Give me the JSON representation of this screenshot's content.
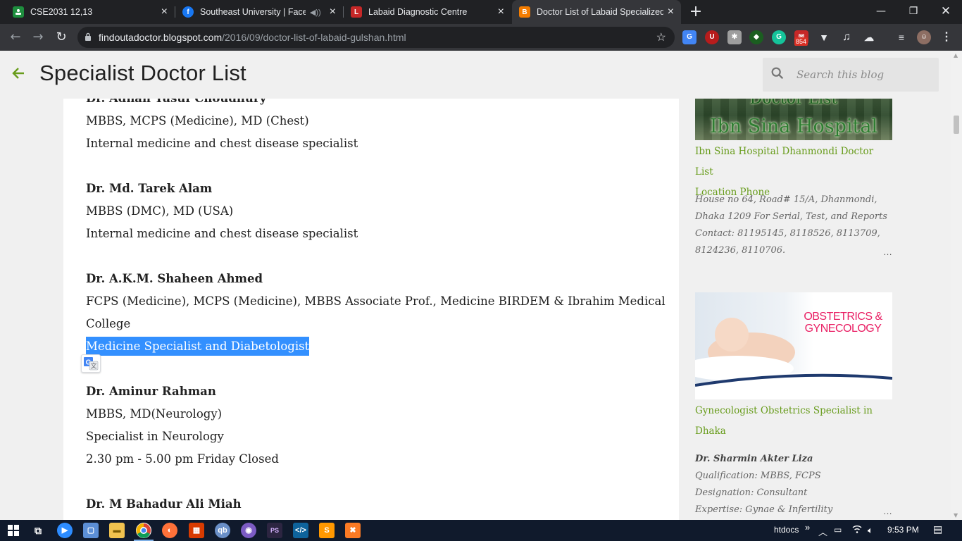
{
  "browser": {
    "tabs": [
      {
        "title": "CSE2031 12,13",
        "favicon": "classroom-icon",
        "color": "#1e8e3e"
      },
      {
        "title": "Southeast University | Facebo",
        "favicon": "facebook-icon",
        "color": "#1877f2"
      },
      {
        "title": "Labaid Diagnostic Centre",
        "favicon": "labaid-icon",
        "color": "#c62828"
      },
      {
        "title": "Doctor List of Labaid Specialized",
        "favicon": "blogger-icon",
        "color": "#f57d00"
      }
    ],
    "url_host": "findoutadoctor.blogspot.com",
    "url_path": "/2016/09/doctor-list-of-labaid-gulshan.html",
    "extension_badge": "854"
  },
  "blog": {
    "title": "Specialist Doctor List",
    "search_placeholder": "Search this blog"
  },
  "content": {
    "lines": [
      {
        "text": "Dr. Adnan Yusuf Choudhury",
        "bold": true
      },
      {
        "text": "MBBS, MCPS (Medicine), MD (Chest)"
      },
      {
        "text": "Internal medicine and chest disease specialist"
      },
      {
        "text": "Dr. Md. Tarek Alam",
        "bold": true
      },
      {
        "text": "MBBS (DMC), MD (USA)"
      },
      {
        "text": "Internal medicine and chest disease specialist"
      },
      {
        "text": "Dr. A.K.M. Shaheen Ahmed",
        "bold": true
      },
      {
        "text": "FCPS (Medicine), MCPS (Medicine), MBBS Associate Prof., Medicine BIRDEM & Ibrahim Medical"
      },
      {
        "text": "College"
      },
      {
        "text": "Medicine Specialist and Diabetologist",
        "selected": true
      },
      {
        "text": "Dr. Aminur Rahman",
        "bold": true
      },
      {
        "text": "MBBS, MD(Neurology)"
      },
      {
        "text": "Specialist in Neurology"
      },
      {
        "text": "2.30 pm - 5.00 pm Friday Closed"
      },
      {
        "text": "Dr. M Bahadur Ali Miah",
        "bold": true
      }
    ]
  },
  "sidebar": {
    "post1": {
      "image_caption_line1": "Doctor List",
      "image_caption_line2": "Ibn Sina Hospital",
      "link_line1": "Ibn Sina Hospital Dhanmondi Doctor List",
      "link_line2": "Location Phone",
      "snippet": [
        "House no 64, Road# 15/A, Dhanmondi,",
        "Dhaka 1209 For Serial, Test, and Reports",
        "Contact: 81195145, 8118526, 8113709,",
        "8124236, 8110706."
      ],
      "more": "…"
    },
    "post2": {
      "image_caption_line1": "OBSTETRICS &",
      "image_caption_line2": "GYNECOLOGY",
      "link_line1": "Gynecologist Obstetrics Specialist in",
      "link_line2": "Dhaka",
      "snippet_name": "Dr. Sharmin Akter Liza",
      "snippet": [
        "Qualification: MBBS, FCPS",
        "Designation: Consultant",
        "Expertise: Gynae & Infertility"
      ],
      "more": "…"
    }
  },
  "taskbar": {
    "tray_label": "htdocs",
    "tray_chevron": "»",
    "time": "9:53 PM"
  },
  "colors": {
    "accent_green": "#689c1c",
    "selection": "#3390ff",
    "chrome_dark": "#202124"
  }
}
